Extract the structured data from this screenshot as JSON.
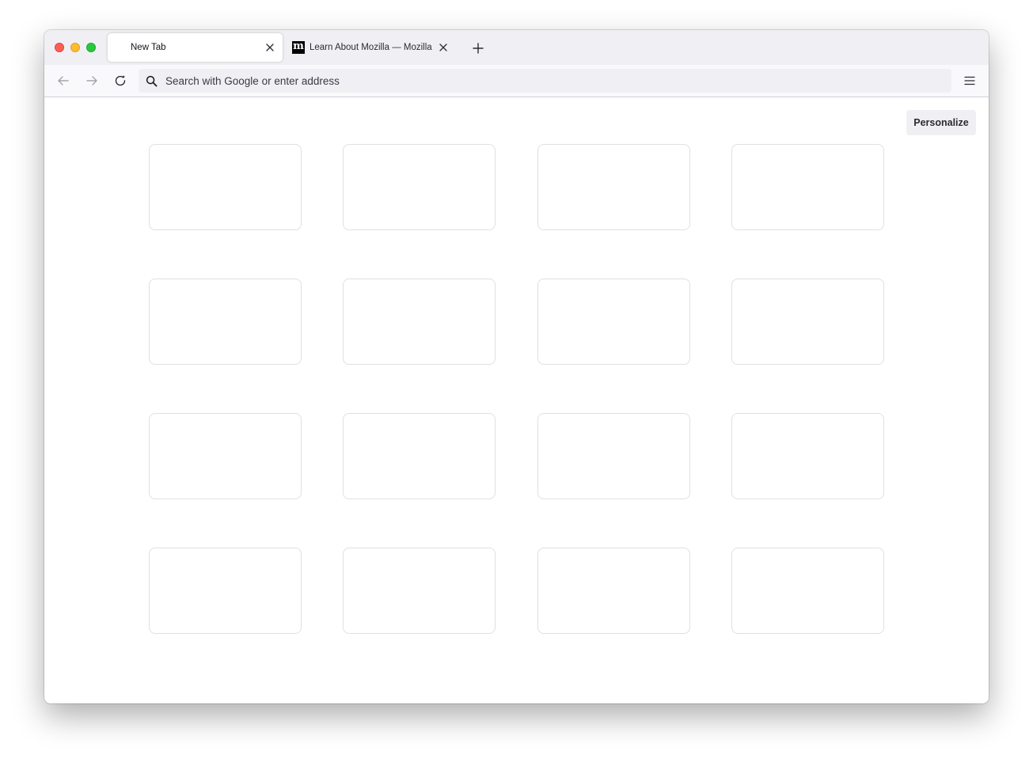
{
  "browser": {
    "tabs": [
      {
        "title": "New Tab",
        "active": true
      },
      {
        "title": "Learn About Mozilla — Mozilla",
        "active": false,
        "favicon": "m"
      }
    ],
    "urlbar": {
      "placeholder": "Search with Google or enter address",
      "value": ""
    },
    "icons": {
      "back": "arrow-left-icon",
      "forward": "arrow-right-icon",
      "reload": "reload-icon",
      "search": "search-icon",
      "menu": "hamburger-menu-icon",
      "new_tab": "plus-icon",
      "close_tab": "close-icon"
    }
  },
  "newtab": {
    "personalize_label": "Personalize",
    "tile_count": 16
  },
  "colors": {
    "close": "#ff5f57",
    "minimize": "#febc2e",
    "maximize": "#28c840",
    "tabstrip_bg": "#f0f0f4",
    "tile_border": "#e0e0e6"
  }
}
